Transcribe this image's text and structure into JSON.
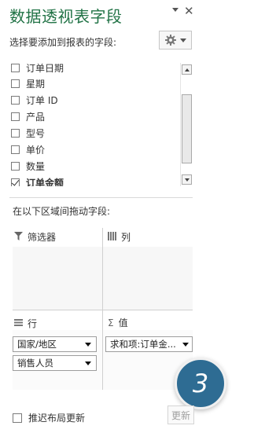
{
  "header": {
    "title": "数据透视表字段",
    "dropdown_icon": "chevron-down-icon",
    "close_label": "✕"
  },
  "field_section": {
    "label": "选择要添加到报表的字段:",
    "settings_icon": "gear-icon"
  },
  "fields": [
    {
      "label": "订单日期",
      "checked": false
    },
    {
      "label": "星期",
      "checked": false
    },
    {
      "label": "订单 ID",
      "checked": false
    },
    {
      "label": "产品",
      "checked": false
    },
    {
      "label": "型号",
      "checked": false
    },
    {
      "label": "单价",
      "checked": false
    },
    {
      "label": "数量",
      "checked": false
    },
    {
      "label": "订单金额",
      "checked": true
    }
  ],
  "areas": {
    "instruction": "在以下区域间拖动字段:",
    "filters": {
      "label": "筛选器",
      "icon": "filter-icon",
      "items": []
    },
    "columns": {
      "label": "列",
      "icon": "columns-icon",
      "items": []
    },
    "rows": {
      "label": "行",
      "icon": "rows-icon",
      "items": [
        "国家/地区",
        "销售人员"
      ]
    },
    "values": {
      "label": "值",
      "icon": "sigma-icon",
      "symbol": "Σ",
      "items": [
        "求和项:订单金..."
      ]
    }
  },
  "step_badge": "3",
  "footer": {
    "defer_label": "推迟布局更新",
    "defer_checked": false,
    "update_label": "更新"
  },
  "colors": {
    "title": "#217346",
    "badge": "#2e6c93"
  }
}
